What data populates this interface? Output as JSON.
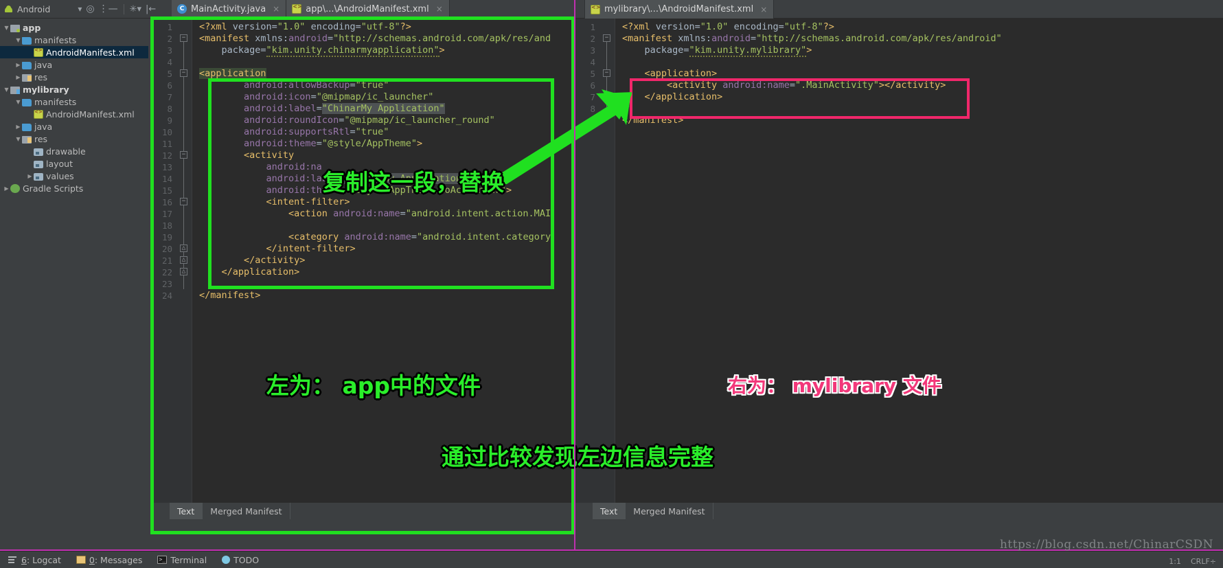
{
  "toolbar": {
    "project_label": "Android",
    "icons": [
      "chevron-down-icon",
      "target-icon",
      "collapse-all-icon",
      "settings-icon",
      "hide-icon"
    ]
  },
  "tabs": [
    {
      "label": "MainActivity.java",
      "icon": "java-class-icon",
      "close": "×",
      "selected": false
    },
    {
      "label": "app\\...\\AndroidManifest.xml",
      "icon": "xml-file-icon",
      "close": "×",
      "selected": true
    },
    {
      "label": "mylibrary\\...\\AndroidManifest.xml",
      "icon": "xml-file-icon",
      "close": "×",
      "selected": true
    }
  ],
  "tree": [
    {
      "label": "app",
      "indent": 0,
      "arrow": "▼",
      "icon": "module-icon",
      "bold": true,
      "selected": false
    },
    {
      "label": "manifests",
      "indent": 1,
      "arrow": "▼",
      "icon": "folder-icon",
      "bold": false,
      "selected": false
    },
    {
      "label": "AndroidManifest.xml",
      "indent": 2,
      "arrow": "",
      "icon": "xml-file-icon",
      "bold": false,
      "selected": true
    },
    {
      "label": "java",
      "indent": 1,
      "arrow": "▶",
      "icon": "folder-icon",
      "bold": false,
      "selected": false
    },
    {
      "label": "res",
      "indent": 1,
      "arrow": "▶",
      "icon": "res-folder-icon",
      "bold": false,
      "selected": false
    },
    {
      "label": "mylibrary",
      "indent": 0,
      "arrow": "▼",
      "icon": "library-module-icon",
      "bold": true,
      "selected": false
    },
    {
      "label": "manifests",
      "indent": 1,
      "arrow": "▼",
      "icon": "folder-icon",
      "bold": false,
      "selected": false
    },
    {
      "label": "AndroidManifest.xml",
      "indent": 2,
      "arrow": "",
      "icon": "xml-file-icon",
      "bold": false,
      "selected": false
    },
    {
      "label": "java",
      "indent": 1,
      "arrow": "▶",
      "icon": "folder-icon",
      "bold": false,
      "selected": false
    },
    {
      "label": "res",
      "indent": 1,
      "arrow": "▼",
      "icon": "res-folder-icon",
      "bold": false,
      "selected": false
    },
    {
      "label": "drawable",
      "indent": 2,
      "arrow": "",
      "icon": "resource-folder-icon",
      "bold": false,
      "selected": false
    },
    {
      "label": "layout",
      "indent": 2,
      "arrow": "",
      "icon": "resource-folder-icon",
      "bold": false,
      "selected": false
    },
    {
      "label": "values",
      "indent": 2,
      "arrow": "▶",
      "icon": "resource-folder-icon",
      "bold": false,
      "selected": false
    },
    {
      "label": "Gradle Scripts",
      "indent": 0,
      "arrow": "▶",
      "icon": "gradle-icon",
      "bold": false,
      "selected": false
    }
  ],
  "editor_left": {
    "file": "app\\...\\AndroidManifest.xml",
    "line_numbers": [
      1,
      2,
      3,
      4,
      5,
      6,
      7,
      8,
      9,
      10,
      11,
      12,
      13,
      14,
      15,
      16,
      17,
      18,
      19,
      20,
      21,
      22,
      23,
      24
    ],
    "lines": [
      "<?xml version=\"1.0\" encoding=\"utf-8\"?>",
      "<manifest xmlns:android=\"http://schemas.android.com/apk/res/and",
      "    package=\"kim.unity.chinarmyapplication\">",
      "",
      "    <application",
      "        android:allowBackup=\"true\"",
      "        android:icon=\"@mipmap/ic_launcher\"",
      "        android:label=\"ChinarMy Application\"",
      "        android:roundIcon=\"@mipmap/ic_launcher_round\"",
      "        android:supportsRtl=\"true\"",
      "        android:theme=\"@style/AppTheme\">",
      "        <activity",
      "            android:na",
      "            android:label=\"ChinarMy Application\"",
      "            android:theme=\"@style/AppTheme.NoActionBar\">",
      "            <intent-filter>",
      "                <action android:name=\"android.intent.action.MAI",
      "",
      "                <category android:name=\"android.intent.category",
      "            </intent-filter>",
      "        </activity>",
      "    </application>",
      "",
      "</manifest>"
    ],
    "bottom_tabs": [
      {
        "label": "Text",
        "selected": true
      },
      {
        "label": "Merged Manifest",
        "selected": false
      }
    ]
  },
  "editor_right": {
    "file": "mylibrary\\...\\AndroidManifest.xml",
    "line_numbers": [
      1,
      2,
      3,
      4,
      5,
      6,
      7,
      8
    ],
    "lines": [
      "<?xml version=\"1.0\" encoding=\"utf-8\"?>",
      "<manifest xmlns:android=\"http://schemas.android.com/apk/res/android\"",
      "    package=\"kim.unity.mylibrary\">",
      "",
      "    <application>",
      "        <activity android:name=\".MainActivity\"></activity>",
      "    </application>",
      "</manifest>"
    ],
    "bottom_tabs": [
      {
        "label": "Text",
        "selected": true
      },
      {
        "label": "Merged Manifest",
        "selected": false
      }
    ]
  },
  "annotations": {
    "copy_replace": "复制这一段，替换",
    "left_is": "左为： app中的文件",
    "right_is": "右为： mylibrary 文件",
    "conclusion": "通过比较发现左边信息完整",
    "green_color": "#2aee2a",
    "pink_color": "#f2387a"
  },
  "statusbar": {
    "items": [
      {
        "num": "6",
        "label": ": Logcat",
        "icon": "logcat-icon"
      },
      {
        "num": "0",
        "label": ": Messages",
        "icon": "messages-icon"
      },
      {
        "num": "",
        "label": "Terminal",
        "icon": "terminal-icon"
      },
      {
        "num": "",
        "label": "TODO",
        "icon": "todo-icon"
      }
    ],
    "caret": "1:1",
    "line_ending": "CRLF÷"
  },
  "watermark": "https://blog.csdn.net/ChinarCSDN"
}
